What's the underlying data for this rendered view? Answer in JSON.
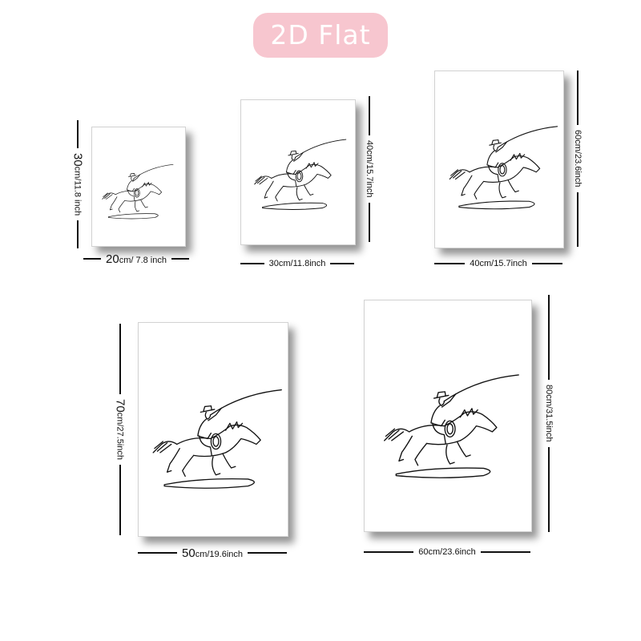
{
  "header": {
    "title": "2D Flat"
  },
  "sizes": [
    {
      "width": "20",
      "width_rest": "cm/ 7.8 inch",
      "height": "30",
      "height_rest": "cm/11.8 inch"
    },
    {
      "width": "30cm/11.8inch",
      "height": "40cm/15.7inch"
    },
    {
      "width": "40cm/15.7inch",
      "height": "60cm/23.6inch"
    },
    {
      "width": "50",
      "width_rest": "cm/19.6inch",
      "height": "70",
      "height_rest": "cm/27.5inch"
    },
    {
      "width": "60cm/23.6inch",
      "height": "80cm/31.5inch"
    }
  ]
}
